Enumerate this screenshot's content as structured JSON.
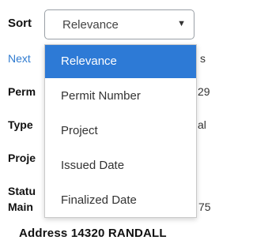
{
  "sort": {
    "label": "Sort",
    "selected_value": "Relevance",
    "caret": "▼",
    "options": [
      "Relevance",
      "Permit Number",
      "Project",
      "Issued Date",
      "Finalized Date"
    ],
    "selected_index": 0,
    "accent_color": "#2d7ad6"
  },
  "background": {
    "next_link": "Next",
    "next_link_tail": "s",
    "labels": [
      "Perm",
      "Type",
      "Proje",
      "Statu",
      "Main"
    ],
    "values": [
      "29",
      "al",
      "75"
    ],
    "address_label": "Address",
    "address_value": "14320 RANDALL"
  }
}
